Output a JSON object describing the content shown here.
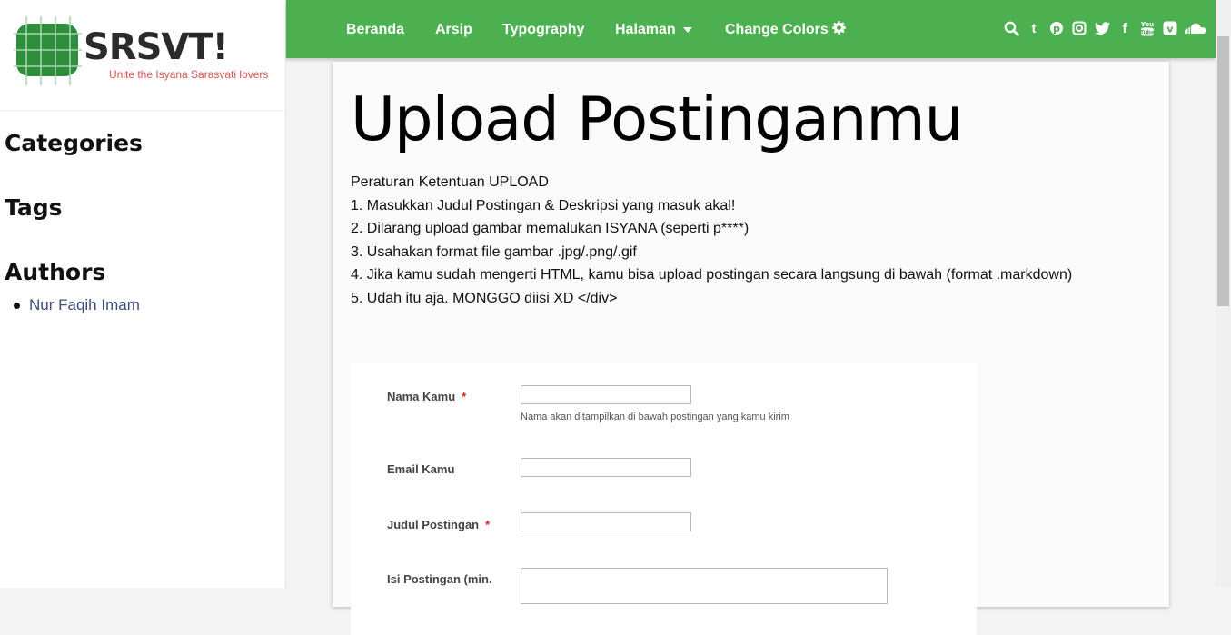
{
  "brand": {
    "name": "SRSVT!",
    "tagline": "Unite the Isyana Sarasvati lovers"
  },
  "sidebar": {
    "categories_heading": "Categories",
    "tags_heading": "Tags",
    "authors_heading": "Authors",
    "authors": [
      "Nur Faqih Imam"
    ]
  },
  "nav": {
    "items": [
      "Beranda",
      "Arsip",
      "Typography",
      "Halaman",
      "Change Colors"
    ],
    "social_icons": [
      "search-icon",
      "tumblr-icon",
      "pinterest-icon",
      "instagram-icon",
      "twitter-icon",
      "facebook-icon",
      "youtube-icon",
      "vimeo-icon",
      "soundcloud-icon"
    ]
  },
  "page": {
    "title": "Upload Postinganmu",
    "rules": [
      "Peraturan Ketentuan UPLOAD",
      "1. Masukkan Judul Postingan & Deskripsi yang masuk akal!",
      "2. Dilarang upload gambar memalukan ISYANA (seperti p****)",
      "3. Usahakan format file gambar .jpg/.png/.gif",
      "4. Jika kamu sudah mengerti HTML, kamu bisa upload postingan secara langsung di bawah (format .markdown)",
      "5. Udah itu aja. MONGGO diisi XD </div>"
    ]
  },
  "form": {
    "name_label": "Nama Kamu",
    "name_help": "Nama akan ditampilkan di bawah postingan yang kamu kirim",
    "email_label": "Email Kamu",
    "title_label": "Judul Postingan",
    "content_label": "Isi Postingan (min.",
    "required_mark": "*"
  },
  "colors": {
    "nav_bg": "#4caf50",
    "required": "#dd2222",
    "tagline": "#d9534f"
  }
}
